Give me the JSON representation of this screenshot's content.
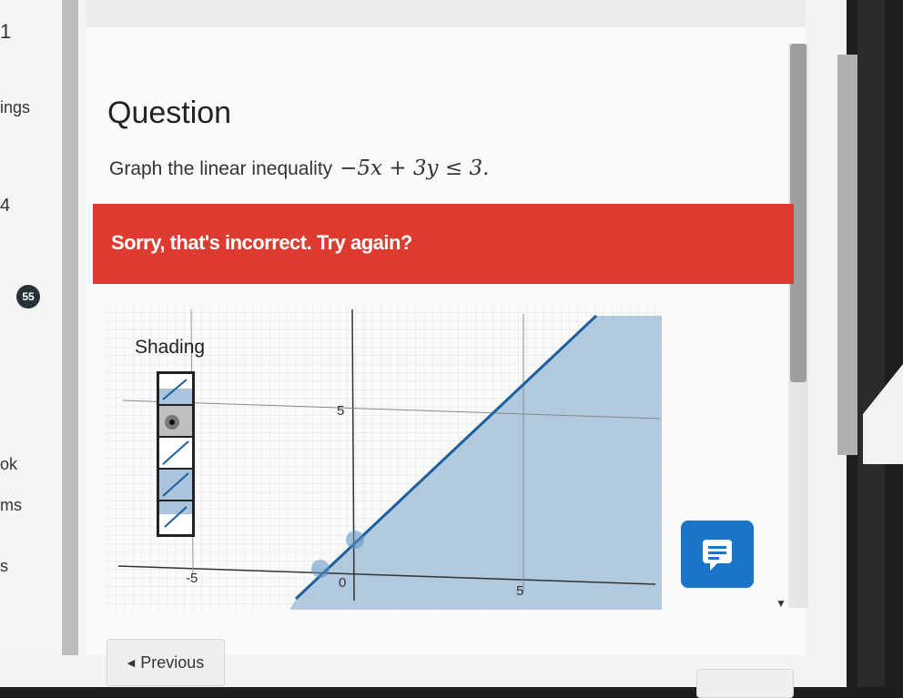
{
  "sidebar": {
    "items": [
      {
        "label": "1"
      },
      {
        "label": "ings"
      },
      {
        "label": "4"
      },
      {
        "label": "55"
      },
      {
        "label": "ok"
      },
      {
        "label": "ms"
      },
      {
        "label": "s"
      }
    ]
  },
  "question": {
    "title": "Question",
    "prompt": "Graph the linear inequality",
    "inequality": "−5x + 3y ≤ 3."
  },
  "feedback": {
    "message": "Sorry, that's incorrect. Try again?",
    "color": "#dd3b30"
  },
  "graph": {
    "label": "Shading",
    "tick_labels": [
      "-5",
      "0",
      "5",
      "5"
    ],
    "shade_color": "#a9c4dc",
    "line_color": "#1d5f9c",
    "boundary": {
      "slope": 1.6667,
      "intercept": 1
    },
    "point_x_intercept": [
      -0.6,
      0
    ],
    "point_y_intercept": [
      0,
      1
    ]
  },
  "nav": {
    "previous_label": "Previous",
    "previous_icon": "caret-left-icon",
    "feedback_icon": "message-icon"
  },
  "colors": {
    "accent": "#1a74c7"
  }
}
